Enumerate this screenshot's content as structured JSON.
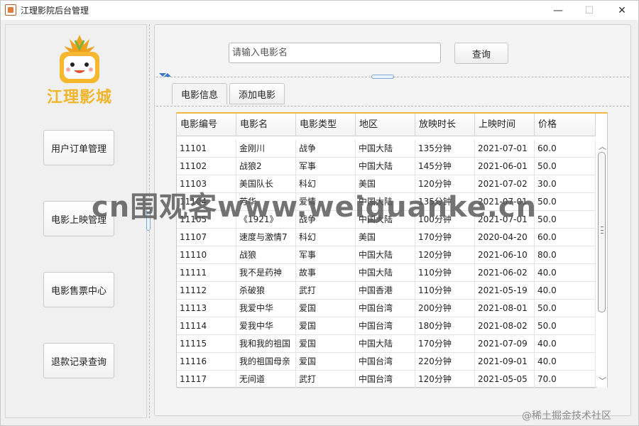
{
  "window": {
    "title": "江理影院后台管理",
    "controls": {
      "minimize": "—",
      "maximize": "☐",
      "close": "✕"
    }
  },
  "sidebar": {
    "logo_text": "江理影城",
    "buttons": [
      {
        "label": "用户订单管理"
      },
      {
        "label": "电影上映管理"
      },
      {
        "label": "电影售票中心"
      },
      {
        "label": "退款记录查询"
      }
    ]
  },
  "search": {
    "placeholder": "请输入电影名",
    "value": "",
    "button_label": "查询"
  },
  "tabs": [
    {
      "label": "电影信息",
      "active": true
    },
    {
      "label": "添加电影",
      "active": false
    }
  ],
  "table": {
    "columns": [
      "电影编号",
      "电影名",
      "电影类型",
      "地区",
      "放映时长",
      "上映时间",
      "价格"
    ],
    "rows": [
      [
        "11101",
        "金刚川",
        "战争",
        "中国大陆",
        "135分钟",
        "2021-07-01",
        "60.0"
      ],
      [
        "11102",
        "战狼2",
        "军事",
        "中国大陆",
        "145分钟",
        "2021-06-01",
        "50.0"
      ],
      [
        "11103",
        "美国队长",
        "科幻",
        "美国",
        "120分钟",
        "2021-07-02",
        "30.0"
      ],
      [
        "11104",
        "芳华",
        "爱情",
        "中国大陆",
        "135分钟",
        "2021-07-01",
        "50.0"
      ],
      [
        "11105",
        "《1921》",
        "战争",
        "中国大陆",
        "100分钟",
        "2021-07-01",
        "50.0"
      ],
      [
        "11107",
        "速度与激情7",
        "科幻",
        "美国",
        "170分钟",
        "2020-04-20",
        "60.0"
      ],
      [
        "11110",
        "战狼",
        "军事",
        "中国大陆",
        "120分钟",
        "2021-06-10",
        "80.0"
      ],
      [
        "11111",
        "我不是药神",
        "故事",
        "中国大陆",
        "110分钟",
        "2021-06-02",
        "40.0"
      ],
      [
        "11112",
        "杀破狼",
        "武打",
        "中国香港",
        "110分钟",
        "2021-05-19",
        "40.0"
      ],
      [
        "11113",
        "我爱中华",
        "爱国",
        "中国台湾",
        "200分钟",
        "2021-08-01",
        "50.0"
      ],
      [
        "11114",
        "爱我中华",
        "爱国",
        "中国台湾",
        "180分钟",
        "2021-08-02",
        "50.0"
      ],
      [
        "11115",
        "我和我的祖国",
        "爱国",
        "中国大陆",
        "170分钟",
        "2021-07-09",
        "40.0"
      ],
      [
        "11116",
        "我的祖国母亲",
        "爱国",
        "中国台湾",
        "220分钟",
        "2021-09-01",
        "40.0"
      ],
      [
        "11117",
        "无间道",
        "武打",
        "中国台湾",
        "120分钟",
        "2021-05-05",
        "70.0"
      ]
    ]
  },
  "overlay": {
    "watermark": "cn围观客www.weiguanke.cn",
    "credit": "@稀土掘金技术社区"
  },
  "colors": {
    "logo_yellow": "#f0b52a",
    "table_accent": "#f5b942",
    "splitter_blue": "#3a77c7"
  }
}
